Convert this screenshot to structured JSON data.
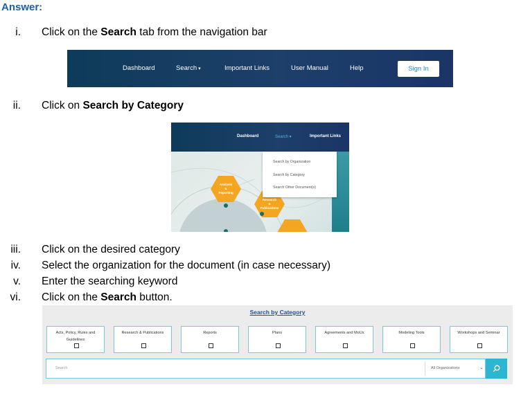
{
  "answer_label": "Answer:",
  "steps": [
    {
      "num": "i.",
      "pre": "Click on the ",
      "bold": "Search",
      "post": " tab from the navigation bar"
    },
    {
      "num": "ii.",
      "pre": "Click on ",
      "bold": "Search by Category",
      "post": ""
    },
    {
      "num": "iii.",
      "pre": "Click on the desired category",
      "bold": "",
      "post": ""
    },
    {
      "num": "iv.",
      "pre": "Select the organization for the document (in case necessary)",
      "bold": "",
      "post": ""
    },
    {
      "num": "v.",
      "pre": "Enter the searching keyword",
      "bold": "",
      "post": ""
    },
    {
      "num": "vi.",
      "pre": "Click on the ",
      "bold": "Search",
      "post": " button."
    }
  ],
  "navbar": {
    "items": [
      "Dashboard",
      "Search",
      "Important Links",
      "User Manual",
      "Help"
    ],
    "caret": "▾",
    "signin": "Sign In"
  },
  "dropdown_shot": {
    "nav_items": [
      "Dashboard",
      "Search ▾",
      "Important Links"
    ],
    "menu_items": [
      "Search by Organization",
      "Search by Category",
      "Search Other Document(s)"
    ],
    "hex_labels": [
      "Analysis\n&\nReporting",
      "Research\n&\nPublications"
    ]
  },
  "category_shot": {
    "title": "Search by Category",
    "categories": [
      "Acts, Policy, Rules and Guidelines",
      "Research & Publications",
      "Reports",
      "Plans",
      "Agreements and MoUs",
      "Modeling Tools",
      "Workshops and Seminar"
    ],
    "search_placeholder": "Search",
    "org_select": "All Organizations",
    "search_icon": "search-icon"
  },
  "colors": {
    "accent": "#1f5fa8",
    "nav_bg": "#1d3f6a",
    "teal": "#2db6d2",
    "hex_orange": "#f4a521"
  }
}
